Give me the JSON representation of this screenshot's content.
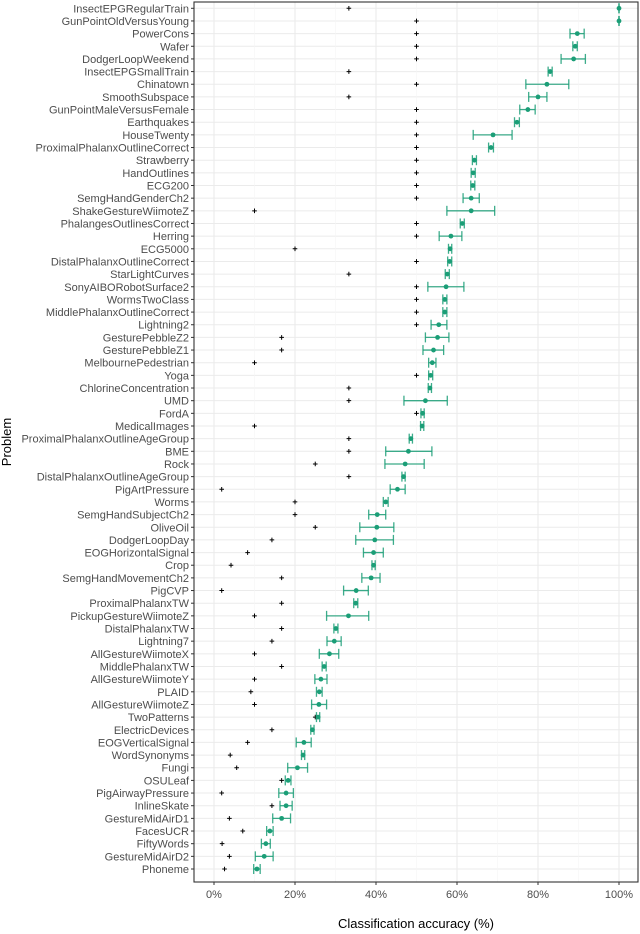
{
  "chart_data": {
    "type": "scatter",
    "subtype": "dot-with-errorbars",
    "title": "",
    "xlabel": "Classification accuracy (%)",
    "ylabel": "Problem",
    "xlim": [
      -5,
      104
    ],
    "x_ticks": [
      0,
      20,
      40,
      60,
      80,
      100
    ],
    "x_tick_labels": [
      "0%",
      "20%",
      "40%",
      "60%",
      "80%",
      "100%"
    ],
    "grid": true,
    "legend": "none",
    "colors": {
      "mean": "#1b9e77",
      "errorbar": "#1b9e77",
      "baseline": "#000000"
    },
    "series": [
      {
        "name": "accuracy_mean",
        "marker": "dot"
      },
      {
        "name": "accuracy_ci",
        "marker": "errorbar"
      },
      {
        "name": "baseline",
        "marker": "plus"
      }
    ],
    "rows": [
      {
        "problem": "InsectEPGRegularTrain",
        "mean": 100,
        "lo": 100,
        "hi": 100,
        "baseline": 33.3
      },
      {
        "problem": "GunPointOldVersusYoung",
        "mean": 100,
        "lo": 100,
        "hi": 100,
        "baseline": 50
      },
      {
        "problem": "PowerCons",
        "mean": 89.7,
        "lo": 87.9,
        "hi": 91.4,
        "baseline": 50
      },
      {
        "problem": "Wafer",
        "mean": 89.2,
        "lo": 88.6,
        "hi": 89.7,
        "baseline": 50
      },
      {
        "problem": "DodgerLoopWeekend",
        "mean": 88.8,
        "lo": 85.7,
        "hi": 91.7,
        "baseline": 50
      },
      {
        "problem": "InsectEPGSmallTrain",
        "mean": 83.0,
        "lo": 82.5,
        "hi": 83.5,
        "baseline": 33.3
      },
      {
        "problem": "Chinatown",
        "mean": 82.2,
        "lo": 77.0,
        "hi": 87.6,
        "baseline": 50
      },
      {
        "problem": "SmoothSubspace",
        "mean": 80.0,
        "lo": 77.7,
        "hi": 82.2,
        "baseline": 33.3
      },
      {
        "problem": "GunPointMaleVersusFemale",
        "mean": 77.5,
        "lo": 75.5,
        "hi": 79.3,
        "baseline": 50
      },
      {
        "problem": "Earthquakes",
        "mean": 74.8,
        "lo": 74.2,
        "hi": 75.4,
        "baseline": 50
      },
      {
        "problem": "HouseTwenty",
        "mean": 68.9,
        "lo": 64.0,
        "hi": 73.6,
        "baseline": 50
      },
      {
        "problem": "ProximalPhalanxOutlineCorrect",
        "mean": 68.4,
        "lo": 67.8,
        "hi": 69.0,
        "baseline": 50
      },
      {
        "problem": "Strawberry",
        "mean": 64.3,
        "lo": 63.8,
        "hi": 64.8,
        "baseline": 50
      },
      {
        "problem": "HandOutlines",
        "mean": 64.0,
        "lo": 63.5,
        "hi": 64.5,
        "baseline": 50
      },
      {
        "problem": "ECG200",
        "mean": 63.9,
        "lo": 63.4,
        "hi": 64.4,
        "baseline": 50
      },
      {
        "problem": "SemgHandGenderCh2",
        "mean": 63.5,
        "lo": 61.5,
        "hi": 65.5,
        "baseline": 50
      },
      {
        "problem": "ShakeGestureWiimoteZ",
        "mean": 63.5,
        "lo": 57.5,
        "hi": 69.3,
        "baseline": 10
      },
      {
        "problem": "PhalangesOutlinesCorrect",
        "mean": 61.3,
        "lo": 60.8,
        "hi": 61.8,
        "baseline": 50
      },
      {
        "problem": "Herring",
        "mean": 58.5,
        "lo": 55.6,
        "hi": 61.2,
        "baseline": 50
      },
      {
        "problem": "ECG5000",
        "mean": 58.3,
        "lo": 57.9,
        "hi": 58.7,
        "baseline": 20
      },
      {
        "problem": "DistalPhalanxOutlineCorrect",
        "mean": 58.2,
        "lo": 57.7,
        "hi": 58.7,
        "baseline": 50
      },
      {
        "problem": "StarLightCurves",
        "mean": 57.6,
        "lo": 57.1,
        "hi": 58.1,
        "baseline": 33.3
      },
      {
        "problem": "SonyAIBORobotSurface2",
        "mean": 57.3,
        "lo": 52.8,
        "hi": 61.7,
        "baseline": 50
      },
      {
        "problem": "WormsTwoClass",
        "mean": 57.0,
        "lo": 56.5,
        "hi": 57.5,
        "baseline": 50
      },
      {
        "problem": "MiddlePhalanxOutlineCorrect",
        "mean": 57.0,
        "lo": 56.5,
        "hi": 57.5,
        "baseline": 50
      },
      {
        "problem": "Lightning2",
        "mean": 55.5,
        "lo": 53.6,
        "hi": 57.5,
        "baseline": 50
      },
      {
        "problem": "GesturePebbleZ2",
        "mean": 55.2,
        "lo": 52.2,
        "hi": 58.0,
        "baseline": 16.7
      },
      {
        "problem": "GesturePebbleZ1",
        "mean": 54.2,
        "lo": 51.6,
        "hi": 56.7,
        "baseline": 16.7
      },
      {
        "problem": "MelbournePedestrian",
        "mean": 53.9,
        "lo": 53.0,
        "hi": 54.8,
        "baseline": 10
      },
      {
        "problem": "Yoga",
        "mean": 53.5,
        "lo": 53.0,
        "hi": 54.0,
        "baseline": 50
      },
      {
        "problem": "ChlorineConcentration",
        "mean": 53.3,
        "lo": 52.9,
        "hi": 53.7,
        "baseline": 33.3
      },
      {
        "problem": "UMD",
        "mean": 52.2,
        "lo": 46.9,
        "hi": 57.6,
        "baseline": 33.3
      },
      {
        "problem": "FordA",
        "mean": 51.5,
        "lo": 51.1,
        "hi": 51.9,
        "baseline": 50
      },
      {
        "problem": "MedicalImages",
        "mean": 51.4,
        "lo": 51.0,
        "hi": 51.8,
        "baseline": 10
      },
      {
        "problem": "ProximalPhalanxOutlineAgeGroup",
        "mean": 48.6,
        "lo": 48.2,
        "hi": 49.0,
        "baseline": 33.3
      },
      {
        "problem": "BME",
        "mean": 48.0,
        "lo": 42.4,
        "hi": 53.8,
        "baseline": 33.3
      },
      {
        "problem": "Rock",
        "mean": 47.2,
        "lo": 42.2,
        "hi": 51.9,
        "baseline": 25
      },
      {
        "problem": "DistalPhalanxOutlineAgeGroup",
        "mean": 46.8,
        "lo": 46.4,
        "hi": 47.2,
        "baseline": 33.3
      },
      {
        "problem": "PigArtPressure",
        "mean": 45.3,
        "lo": 43.5,
        "hi": 47.2,
        "baseline": 1.9
      },
      {
        "problem": "Worms",
        "mean": 42.4,
        "lo": 41.8,
        "hi": 43.0,
        "baseline": 20
      },
      {
        "problem": "SemgHandSubjectCh2",
        "mean": 40.3,
        "lo": 38.2,
        "hi": 42.4,
        "baseline": 20
      },
      {
        "problem": "OliveOil",
        "mean": 40.2,
        "lo": 36.0,
        "hi": 44.4,
        "baseline": 25
      },
      {
        "problem": "DodgerLoopDay",
        "mean": 39.7,
        "lo": 35.0,
        "hi": 44.3,
        "baseline": 14.3
      },
      {
        "problem": "EOGHorizontalSignal",
        "mean": 39.4,
        "lo": 36.9,
        "hi": 41.8,
        "baseline": 8.3
      },
      {
        "problem": "Crop",
        "mean": 39.4,
        "lo": 39.0,
        "hi": 39.8,
        "baseline": 4.2
      },
      {
        "problem": "SemgHandMovementCh2",
        "mean": 38.8,
        "lo": 36.5,
        "hi": 41.0,
        "baseline": 16.7
      },
      {
        "problem": "PigCVP",
        "mean": 35.1,
        "lo": 32.0,
        "hi": 38.1,
        "baseline": 1.9
      },
      {
        "problem": "ProximalPhalanxTW",
        "mean": 35.0,
        "lo": 34.5,
        "hi": 35.5,
        "baseline": 16.7
      },
      {
        "problem": "PickupGestureWiimoteZ",
        "mean": 33.2,
        "lo": 27.8,
        "hi": 38.2,
        "baseline": 10
      },
      {
        "problem": "DistalPhalanxTW",
        "mean": 30.1,
        "lo": 29.6,
        "hi": 30.6,
        "baseline": 16.7
      },
      {
        "problem": "Lightning7",
        "mean": 29.7,
        "lo": 27.9,
        "hi": 31.4,
        "baseline": 14.3
      },
      {
        "problem": "AllGestureWiimoteX",
        "mean": 28.5,
        "lo": 26.0,
        "hi": 30.8,
        "baseline": 10
      },
      {
        "problem": "MiddlePhalanxTW",
        "mean": 27.2,
        "lo": 26.7,
        "hi": 27.7,
        "baseline": 16.7
      },
      {
        "problem": "AllGestureWiimoteY",
        "mean": 26.4,
        "lo": 24.9,
        "hi": 27.9,
        "baseline": 10
      },
      {
        "problem": "PLAID",
        "mean": 26.0,
        "lo": 25.3,
        "hi": 26.7,
        "baseline": 9.1
      },
      {
        "problem": "AllGestureWiimoteZ",
        "mean": 25.9,
        "lo": 24.1,
        "hi": 27.8,
        "baseline": 10
      },
      {
        "problem": "TwoPatterns",
        "mean": 25.7,
        "lo": 25.3,
        "hi": 26.1,
        "baseline": 25
      },
      {
        "problem": "ElectricDevices",
        "mean": 24.3,
        "lo": 23.9,
        "hi": 24.7,
        "baseline": 14.3
      },
      {
        "problem": "EOGVerticalSignal",
        "mean": 22.2,
        "lo": 20.3,
        "hi": 24.0,
        "baseline": 8.3
      },
      {
        "problem": "WordSynonyms",
        "mean": 22.0,
        "lo": 21.6,
        "hi": 22.4,
        "baseline": 4.0
      },
      {
        "problem": "Fungi",
        "mean": 20.6,
        "lo": 18.2,
        "hi": 23.1,
        "baseline": 5.6
      },
      {
        "problem": "OSULeaf",
        "mean": 18.3,
        "lo": 17.6,
        "hi": 19.0,
        "baseline": 16.7
      },
      {
        "problem": "PigAirwayPressure",
        "mean": 17.8,
        "lo": 16.0,
        "hi": 19.6,
        "baseline": 1.9
      },
      {
        "problem": "InlineSkate",
        "mean": 17.8,
        "lo": 16.3,
        "hi": 19.3,
        "baseline": 14.3
      },
      {
        "problem": "GestureMidAirD1",
        "mean": 16.7,
        "lo": 14.5,
        "hi": 18.9,
        "baseline": 3.8
      },
      {
        "problem": "FacesUCR",
        "mean": 13.8,
        "lo": 13.0,
        "hi": 14.6,
        "baseline": 7.1
      },
      {
        "problem": "FiftyWords",
        "mean": 12.8,
        "lo": 11.7,
        "hi": 13.9,
        "baseline": 2.0
      },
      {
        "problem": "GestureMidAirD2",
        "mean": 12.4,
        "lo": 10.2,
        "hi": 14.6,
        "baseline": 3.8
      },
      {
        "problem": "Phoneme",
        "mean": 10.6,
        "lo": 9.8,
        "hi": 11.4,
        "baseline": 2.6
      }
    ]
  }
}
